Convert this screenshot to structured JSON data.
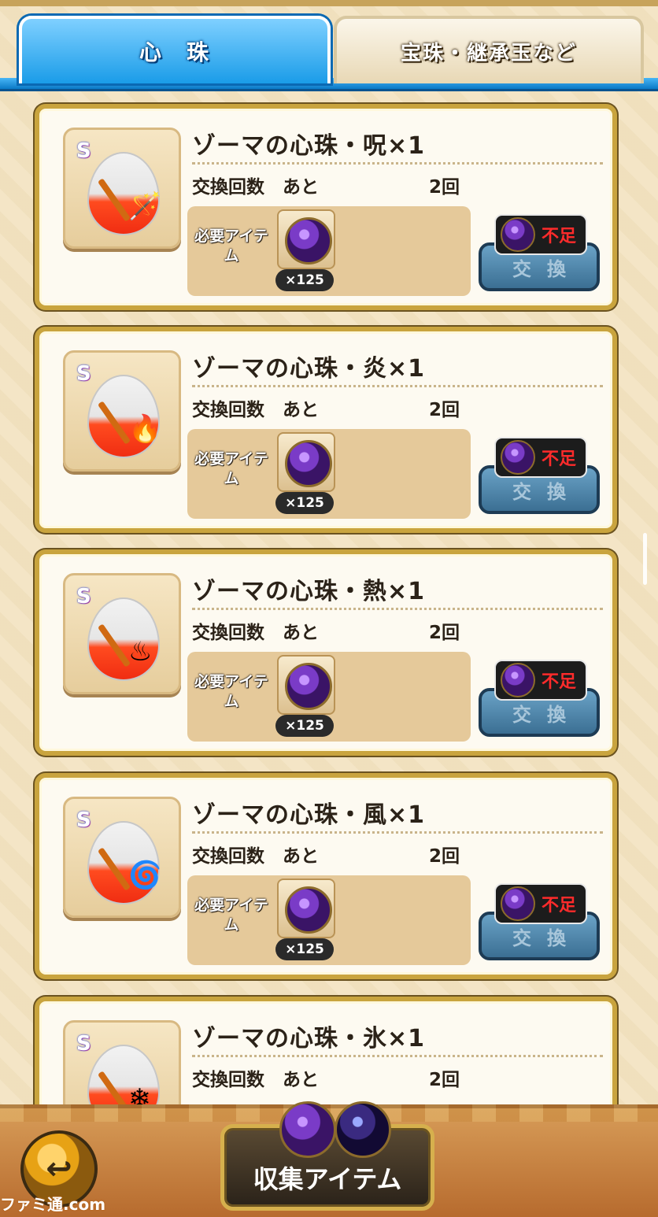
{
  "tabs": [
    {
      "label": "心　珠",
      "active": true
    },
    {
      "label": "宝珠・継承玉など",
      "active": false
    }
  ],
  "items": [
    {
      "title": "ゾーマの心珠・呪×1",
      "count_label": "交換回数　あと",
      "count_value": "2回",
      "req_label": "必要アイテム",
      "qty": "×125",
      "exchange_label": "交換",
      "shortage_label": "不足",
      "element_icon": "curse",
      "grade": "S"
    },
    {
      "title": "ゾーマの心珠・炎×1",
      "count_label": "交換回数　あと",
      "count_value": "2回",
      "req_label": "必要アイテム",
      "qty": "×125",
      "exchange_label": "交換",
      "shortage_label": "不足",
      "element_icon": "flame",
      "grade": "S"
    },
    {
      "title": "ゾーマの心珠・熱×1",
      "count_label": "交換回数　あと",
      "count_value": "2回",
      "req_label": "必要アイテム",
      "qty": "×125",
      "exchange_label": "交換",
      "shortage_label": "不足",
      "element_icon": "heat",
      "grade": "S"
    },
    {
      "title": "ゾーマの心珠・風×1",
      "count_label": "交換回数　あと",
      "count_value": "2回",
      "req_label": "必要アイテム",
      "qty": "×125",
      "exchange_label": "交換",
      "shortage_label": "不足",
      "element_icon": "wind",
      "grade": "S"
    },
    {
      "title": "ゾーマの心珠・氷×1",
      "count_label": "交換回数　あと",
      "count_value": "2回",
      "element_icon": "ice",
      "grade": "S"
    }
  ],
  "bottom": {
    "back_label": "↩",
    "collect_label": "収集アイテム"
  },
  "watermark": "ファミ通.com"
}
